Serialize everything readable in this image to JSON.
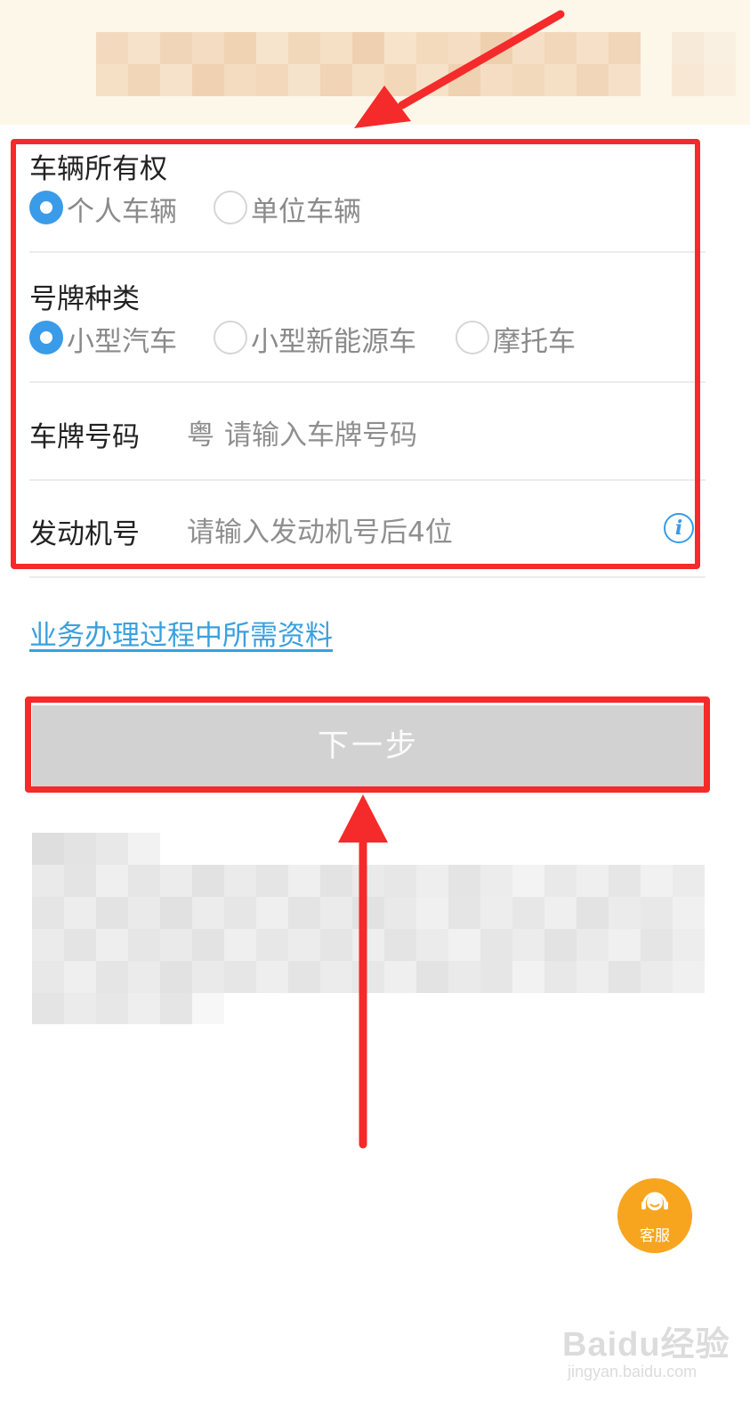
{
  "ownership": {
    "label": "车辆所有权",
    "options": [
      {
        "label": "个人车辆",
        "selected": true
      },
      {
        "label": "单位车辆",
        "selected": false
      }
    ]
  },
  "plate_type": {
    "label": "号牌种类",
    "options": [
      {
        "label": "小型汽车",
        "selected": true
      },
      {
        "label": "小型新能源车",
        "selected": false
      },
      {
        "label": "摩托车",
        "selected": false
      }
    ]
  },
  "plate_number": {
    "label": "车牌号码",
    "prefix": "粤",
    "placeholder": "请输入车牌号码"
  },
  "engine_number": {
    "label": "发动机号",
    "placeholder": "请输入发动机号后4位",
    "info_icon": "info-icon"
  },
  "docs_link": "业务办理过程中所需资料",
  "next_button": "下一步",
  "customer_service": {
    "label": "客服",
    "icon": "headset-icon"
  },
  "watermark": {
    "brand": "Baidu经验",
    "url": "jingyan.baidu.com"
  },
  "colors": {
    "accent": "#3a9be8",
    "link": "#3aa0de",
    "annotation_red": "#f52a2a",
    "button_disabled": "#d2d2d2",
    "service_orange": "#f7a51f"
  }
}
